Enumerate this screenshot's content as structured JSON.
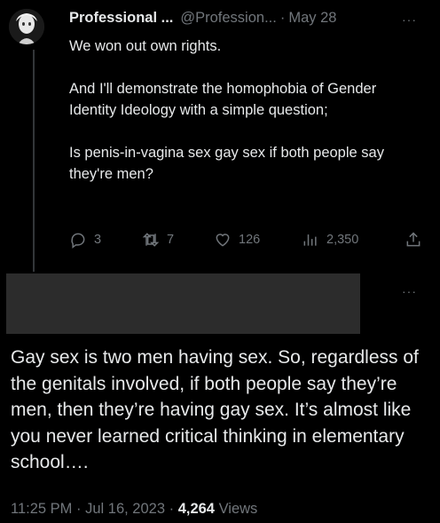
{
  "tweet": {
    "author_name": "Professional ...",
    "handle": "@Profession...",
    "separator": "·",
    "date": "May 28",
    "more": "···",
    "paragraphs": [
      "We won out own rights.",
      "And I'll demonstrate the homophobia of Gender Identity Ideology with a simple question;",
      "Is penis-in-vagina sex gay sex if both people say they're men?"
    ],
    "actions": {
      "replies": "3",
      "retweets": "7",
      "likes": "126",
      "views": "2,350"
    }
  },
  "reply": {
    "more": "···",
    "text": "Gay sex is two men having sex. So, regardless of the genitals involved, if both people say they’re men, then they’re having gay sex. It’s almost like you never learned critical thinking in elementary school….",
    "time": "11:25 PM",
    "date": "Jul 16, 2023",
    "separator": "·",
    "views_count": "4,264",
    "views_label": "Views"
  },
  "colors": {
    "background": "#000000",
    "text": "#e7e9ea",
    "muted": "#71767b",
    "redaction": "#2c2c2c"
  },
  "icons": [
    "reply-icon",
    "retweet-icon",
    "like-icon",
    "views-icon",
    "share-icon",
    "more-icon"
  ]
}
